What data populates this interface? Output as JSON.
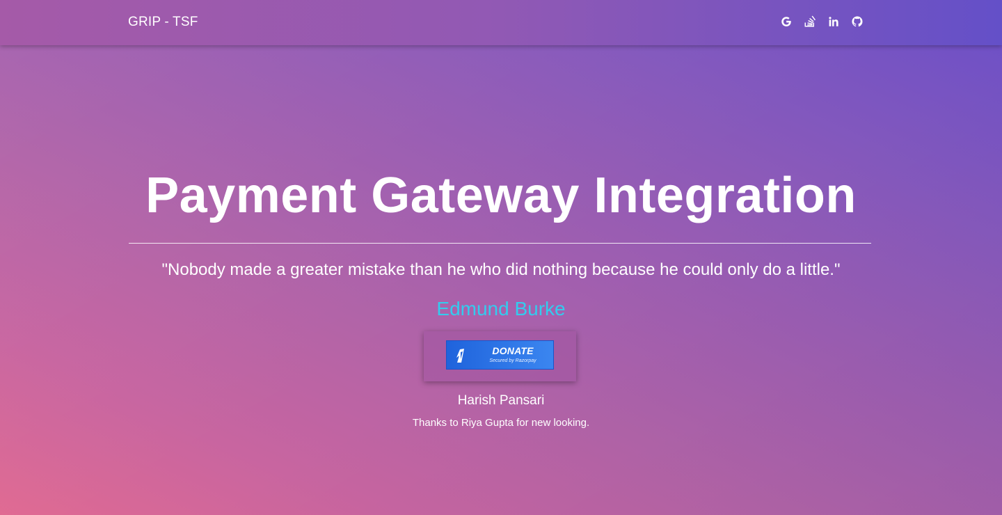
{
  "navbar": {
    "brand": "GRIP - TSF",
    "social": [
      {
        "icon": "google-icon",
        "glyph": "G"
      },
      {
        "icon": "stackoverflow-icon"
      },
      {
        "icon": "linkedin-icon",
        "glyph": "in"
      },
      {
        "icon": "github-icon"
      }
    ]
  },
  "hero": {
    "title": "Payment Gateway Integration",
    "quote": "\"Nobody made a greater mistake than he who did nothing because he could only do a little.\"",
    "author": "Edmund Burke"
  },
  "donate": {
    "label": "DONATE",
    "sub_label": "Secured by Razorpay"
  },
  "footer": {
    "name": "Harish Pansari",
    "thanks": "Thanks to Riya Gupta for new looking."
  },
  "colors": {
    "accent_author": "#33ccee",
    "donate_blue": "#2f74e6",
    "gradient_start": "#e06a92",
    "gradient_end": "#6a4fc8"
  }
}
